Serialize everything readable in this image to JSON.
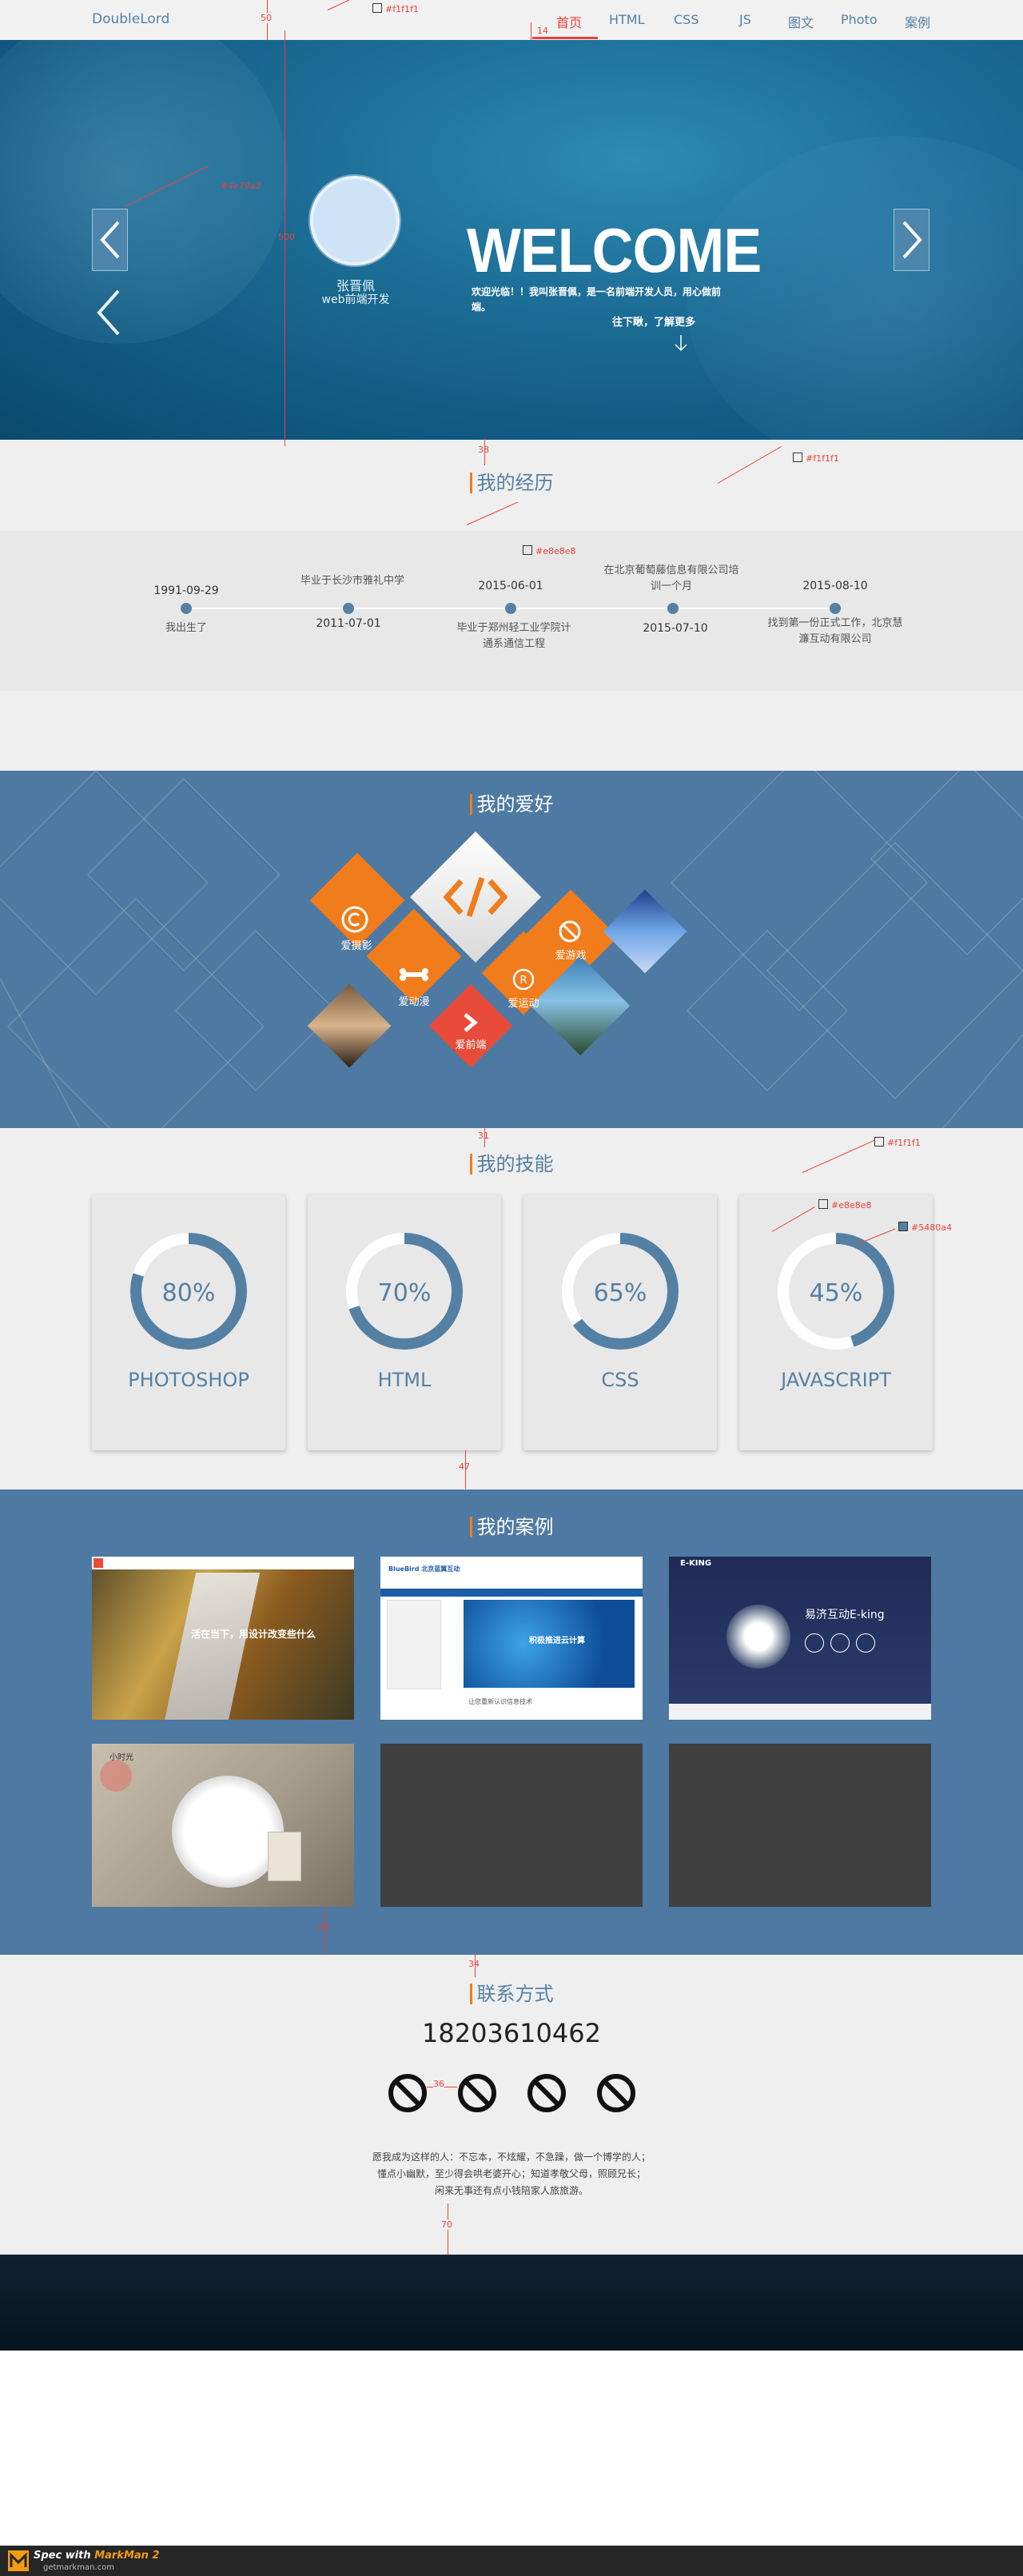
{
  "nav": {
    "logo": "DoubleLord",
    "items": [
      "首页",
      "HTML",
      "CSS",
      "JS",
      "图文",
      "Photo",
      "案例"
    ]
  },
  "hero": {
    "name": "张晋佩",
    "role": "web前端开发",
    "welcome": "WELCOME",
    "intro": "欢迎光临！！我叫张晋佩，是一名前端开发人员，用心做前端。",
    "more": "往下瞅，了解更多",
    "slides": 7,
    "active_slide": 2
  },
  "experience": {
    "title": "我的经历",
    "top": [
      {
        "text": "1991-09-29",
        "kind": "date"
      },
      {
        "text": "毕业于长沙市雅礼中学",
        "kind": "desc"
      },
      {
        "text": "2015-06-01",
        "kind": "date"
      },
      {
        "text": "在北京葡萄藤信息有限公司培训一个月",
        "kind": "desc"
      },
      {
        "text": "2015-08-10",
        "kind": "date"
      }
    ],
    "bottom": [
      {
        "text": "我出生了",
        "kind": "desc"
      },
      {
        "text": "2011-07-01",
        "kind": "date"
      },
      {
        "text": "毕业于郑州轻工业学院计通系通信工程",
        "kind": "desc"
      },
      {
        "text": "2015-07-10",
        "kind": "date"
      },
      {
        "text": "找到第一份正式工作，北京慧濂互动有限公司",
        "kind": "desc"
      }
    ]
  },
  "hobbies": {
    "title": "我的爱好",
    "items": [
      "爱摄影",
      "爱动漫",
      "爱游戏",
      "爱运动",
      "爱前端"
    ]
  },
  "skills": {
    "title": "我的技能",
    "items": [
      {
        "name": "PHOTOSHOP",
        "percent": 80,
        "label": "80%"
      },
      {
        "name": "HTML",
        "percent": 70,
        "label": "70%"
      },
      {
        "name": "CSS",
        "percent": 65,
        "label": "65%"
      },
      {
        "name": "JAVASCRIPT",
        "percent": 45,
        "label": "45%"
      }
    ]
  },
  "cases": {
    "title": "我的案例",
    "case1_text": "活在当下，用设计改变些什么",
    "case2_brand": "BlueBird 北京蓝翼互动",
    "case2_headline": "积极推进云计算",
    "case2_sub": "让您重新认识信息技术",
    "case3_brand": "E-KING",
    "case3_headline": "易济互动E-king",
    "case4_brand": "小时光"
  },
  "contact": {
    "title": "联系方式",
    "phone": "18203610462",
    "motto_lines": [
      "愿我成为这样的人：不忘本，不炫耀，不急躁，做一个博学的人；",
      "懂点小幽默，至少得会哄老婆开心；知道孝敬父母，照顾兄长；",
      "闲来无事还有点小钱陪家人旅旅游。"
    ]
  },
  "annotations": {
    "nav_color": "#f1f1f1",
    "tl_color": "#e8e8e8",
    "hero_bg_color": "#4e79a2",
    "hero_height": "500",
    "card_color": "#e8e8e8",
    "accent": "#5480a4",
    "exp_section_color": "#f1f1f1",
    "skills_section_color": "#f1f1f1",
    "spacing": [
      "50",
      "14",
      "38",
      "31",
      "47",
      "60",
      "34",
      "36",
      "70"
    ]
  },
  "markman": {
    "title_a": "Spec with ",
    "title_b": "MarkMan 2",
    "url": "getmarkman.com"
  },
  "colors": {
    "accent": "#5480a4",
    "nav_active": "#e8433a",
    "orange": "#f07c1b",
    "section_blue": "#4e79a2"
  }
}
